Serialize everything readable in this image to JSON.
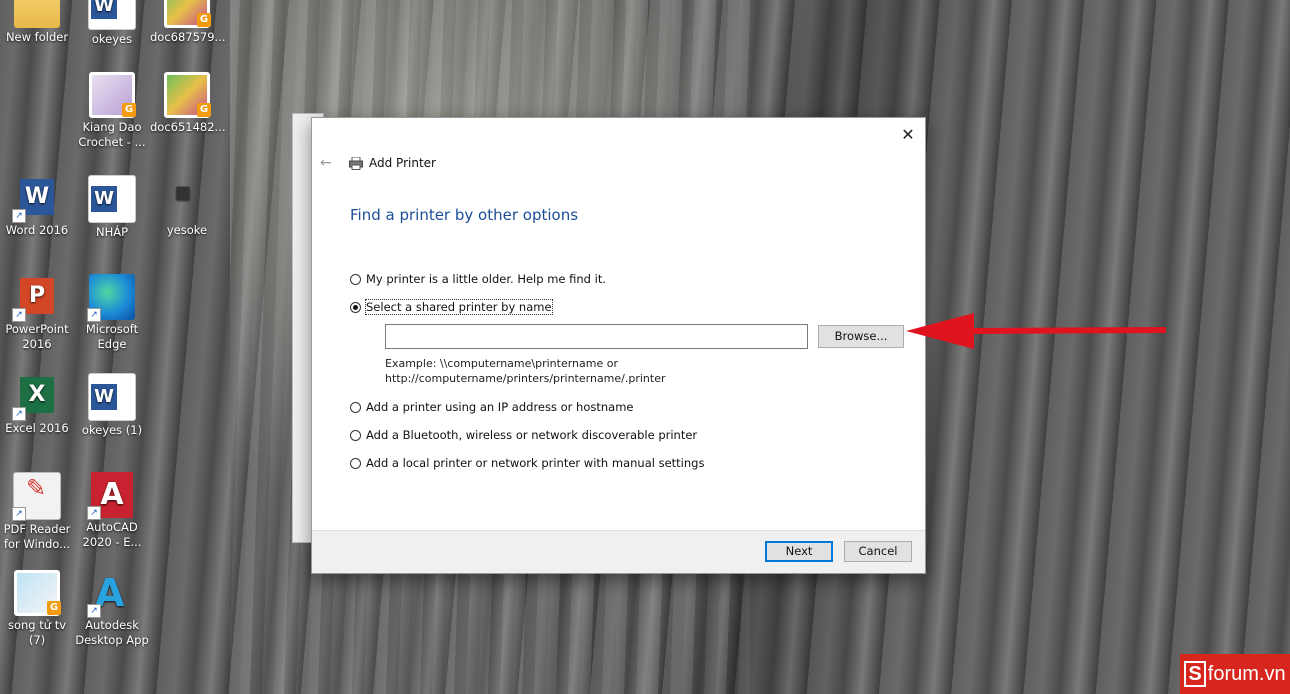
{
  "desktop": {
    "icons": [
      {
        "label": "New folder"
      },
      {
        "label": "okeyes"
      },
      {
        "label": "doc687579..."
      },
      {
        "label": "Kiang Dao\nCrochet - ..."
      },
      {
        "label": "doc651482..."
      },
      {
        "label": "Word 2016"
      },
      {
        "label": "NHÁP"
      },
      {
        "label": "yesoke"
      },
      {
        "label": "PowerPoint\n2016"
      },
      {
        "label": "Microsoft\nEdge"
      },
      {
        "label": "Excel 2016"
      },
      {
        "label": "okeyes (1)"
      },
      {
        "label": "PDF Reader\nfor Windo..."
      },
      {
        "label": "AutoCAD\n2020 - E..."
      },
      {
        "label": "song tử tv (7)"
      },
      {
        "label": "Autodesk\nDesktop App"
      }
    ]
  },
  "dialog": {
    "title": "Add Printer",
    "heading": "Find a printer by other options",
    "options": [
      {
        "label": "My printer is a little older. Help me find it.",
        "checked": false
      },
      {
        "label": "Select a shared printer by name",
        "checked": true
      },
      {
        "label": "Add a printer using an IP address or hostname",
        "checked": false
      },
      {
        "label": "Add a Bluetooth, wireless or network discoverable printer",
        "checked": false
      },
      {
        "label": "Add a local printer or network printer with manual settings",
        "checked": false
      }
    ],
    "name_input": {
      "value": "",
      "placeholder": ""
    },
    "browse_label": "Browse...",
    "example_line1": "Example: \\\\computername\\printername or",
    "example_line2": "http://computername/printers/printername/.printer",
    "next_label": "Next",
    "cancel_label": "Cancel"
  },
  "annotation": {
    "arrow_color": "#e0141e"
  },
  "watermark": {
    "s": "S",
    "text": "forum.vn"
  }
}
